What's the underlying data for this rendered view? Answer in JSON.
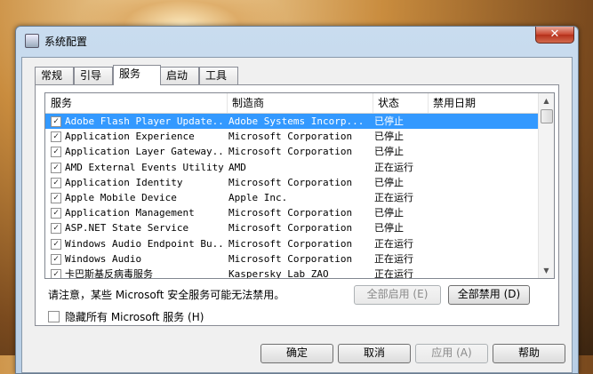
{
  "window": {
    "title": "系统配置",
    "close_glyph": "✕"
  },
  "tabs": [
    "常规",
    "引导",
    "服务",
    "启动",
    "工具"
  ],
  "active_tab": "服务",
  "list": {
    "columns": [
      "服务",
      "制造商",
      "状态",
      "禁用日期"
    ],
    "rows": [
      {
        "checked": true,
        "service": "Adobe Flash Player Update...",
        "maker": "Adobe Systems Incorp...",
        "status": "已停止",
        "date": "",
        "selected": true
      },
      {
        "checked": true,
        "service": "Application Experience",
        "maker": "Microsoft Corporation",
        "status": "已停止",
        "date": ""
      },
      {
        "checked": true,
        "service": "Application Layer Gateway...",
        "maker": "Microsoft Corporation",
        "status": "已停止",
        "date": ""
      },
      {
        "checked": true,
        "service": "AMD External Events Utility",
        "maker": "AMD",
        "status": "正在运行",
        "date": ""
      },
      {
        "checked": true,
        "service": "Application Identity",
        "maker": "Microsoft Corporation",
        "status": "已停止",
        "date": ""
      },
      {
        "checked": true,
        "service": "Apple Mobile Device",
        "maker": "Apple Inc.",
        "status": "正在运行",
        "date": ""
      },
      {
        "checked": true,
        "service": "Application Management",
        "maker": "Microsoft Corporation",
        "status": "已停止",
        "date": ""
      },
      {
        "checked": true,
        "service": "ASP.NET State Service",
        "maker": "Microsoft Corporation",
        "status": "已停止",
        "date": ""
      },
      {
        "checked": true,
        "service": "Windows Audio Endpoint Bu...",
        "maker": "Microsoft Corporation",
        "status": "正在运行",
        "date": ""
      },
      {
        "checked": true,
        "service": "Windows Audio",
        "maker": "Microsoft Corporation",
        "status": "正在运行",
        "date": ""
      },
      {
        "checked": true,
        "service": "卡巴斯基反病毒服务",
        "maker": "Kaspersky Lab ZAO",
        "status": "正在运行",
        "date": ""
      }
    ]
  },
  "note": "请注意，某些 Microsoft 安全服务可能无法禁用。",
  "enable_all_label": "全部启用 (E)",
  "disable_all_label": "全部禁用 (D)",
  "hide_ms_label": "隐藏所有 Microsoft 服务 (H)",
  "buttons": {
    "ok": "确定",
    "cancel": "取消",
    "apply": "应用 (A)",
    "help": "帮助"
  },
  "selection_color": "#3399ff"
}
